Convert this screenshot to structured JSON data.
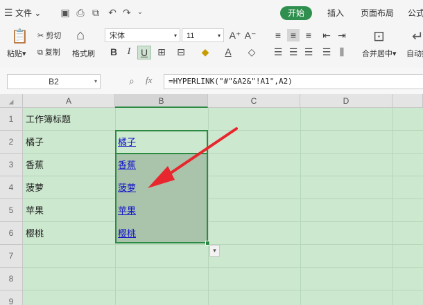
{
  "menu": {
    "file_label": "文件",
    "tabs": [
      {
        "label": "开始",
        "active": true
      },
      {
        "label": "插入"
      },
      {
        "label": "页面布局"
      },
      {
        "label": "公式"
      }
    ]
  },
  "ribbon": {
    "paste_label": "粘贴",
    "cut_label": "剪切",
    "copy_label": "复制",
    "format_painter_label": "格式刷",
    "font_name": "宋体",
    "font_size": "11",
    "merge_label": "合并居中",
    "autowrap_label": "自动换"
  },
  "formula_bar": {
    "name_box": "B2",
    "fx_label": "fx",
    "formula": "=HYPERLINK(\"#\"&A2&\"!A1\",A2)"
  },
  "sheet": {
    "columns": [
      "A",
      "B",
      "C",
      "D"
    ],
    "rows": [
      "1",
      "2",
      "3",
      "4",
      "5",
      "6",
      "7",
      "8",
      "9"
    ],
    "cells": {
      "A1": "工作簿标题",
      "A2": "橘子",
      "A3": "香蕉",
      "A4": "菠萝",
      "A5": "苹果",
      "A6": "樱桃",
      "B2": "橘子",
      "B3": "香蕉",
      "B4": "菠萝",
      "B5": "苹果",
      "B6": "樱桃"
    },
    "selected_range": "B2:B6"
  },
  "colors": {
    "accent": "#2f8f4e",
    "sheet_bg": "#cce8cf",
    "link": "#1515c8",
    "annotation_arrow": "#e8262e"
  }
}
